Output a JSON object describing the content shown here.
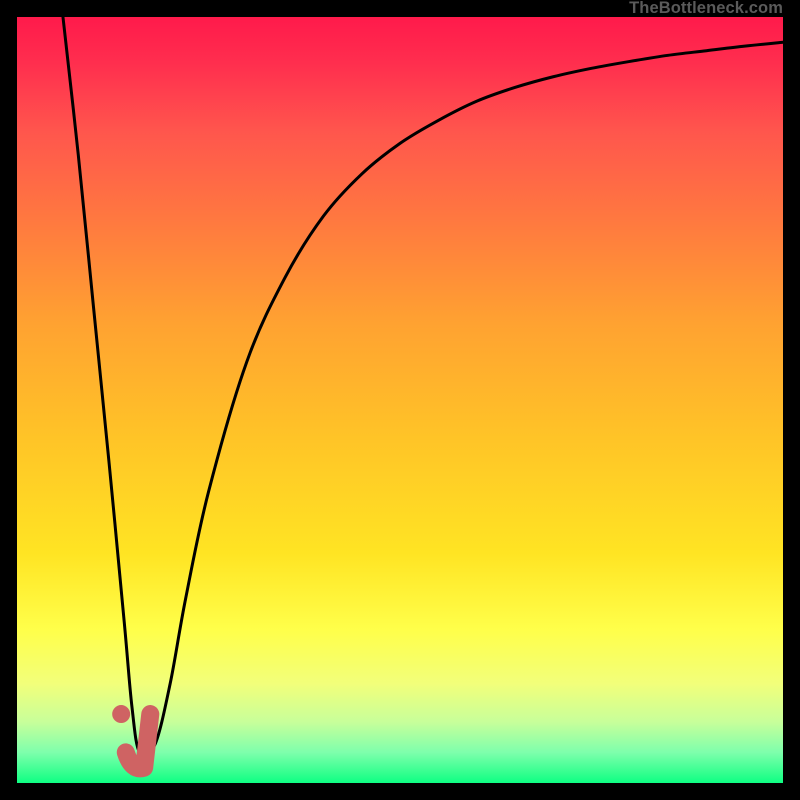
{
  "header": {
    "site_name": "TheBottleneck.com"
  },
  "colors": {
    "page_bg": "#000000",
    "gradient_top": "#ff1a4b",
    "gradient_bottom": "#0eff84",
    "curve": "#000000",
    "marker": "#cf6363",
    "title_text": "#5a5a5a"
  },
  "chart_data": {
    "type": "line",
    "title": "",
    "xlabel": "",
    "ylabel": "",
    "xlim": [
      0,
      100
    ],
    "ylim": [
      0,
      100
    ],
    "series": [
      {
        "name": "bottleneck-curve",
        "x": [
          6,
          8,
          10,
          12,
          14,
          15,
          16,
          18,
          20,
          22,
          25,
          30,
          35,
          40,
          45,
          50,
          55,
          60,
          65,
          70,
          75,
          80,
          85,
          90,
          95,
          100
        ],
        "values": [
          100,
          82,
          62,
          42,
          21,
          10,
          4,
          5,
          13,
          24,
          38,
          55,
          66,
          74,
          79.5,
          83.5,
          86.5,
          89,
          90.8,
          92.2,
          93.3,
          94.2,
          95,
          95.6,
          96.2,
          96.7
        ]
      }
    ],
    "markers": {
      "trough_x": 15.5,
      "trough_y": 3,
      "segment": [
        {
          "x": 14.2,
          "y": 4
        },
        {
          "x": 15.0,
          "y": 2
        },
        {
          "x": 16.6,
          "y": 2
        },
        {
          "x": 17.4,
          "y": 9
        }
      ],
      "dot": {
        "x": 13.6,
        "y": 9
      }
    }
  }
}
